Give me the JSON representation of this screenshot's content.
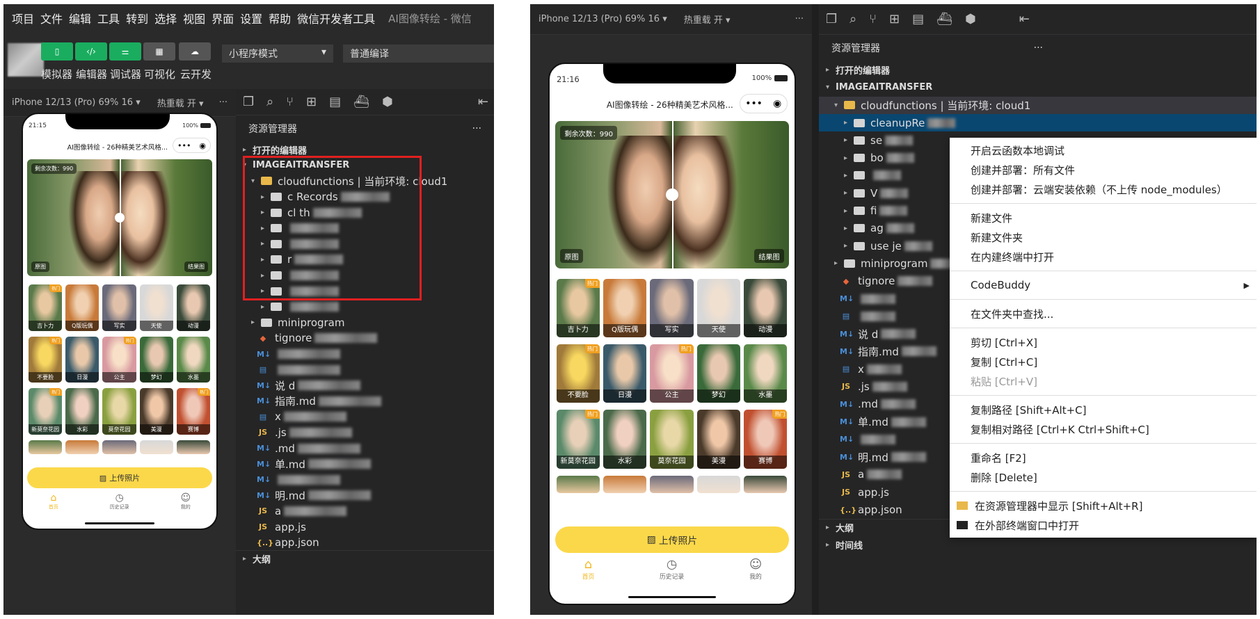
{
  "menu": [
    "项目",
    "文件",
    "编辑",
    "工具",
    "转到",
    "选择",
    "视图",
    "界面",
    "设置",
    "帮助",
    "微信开发者工具"
  ],
  "window_title": "AI图像转绘 - 微信",
  "toolbar": {
    "buttons": [
      "模拟器",
      "编辑器",
      "调试器",
      "可视化",
      "云开发"
    ],
    "mode_select": "小程序模式",
    "compile_select": "普通编译"
  },
  "device_bar": {
    "device": "iPhone 12/13 (Pro) 69% 16 ▾",
    "hot_reload": "热重载 开 ▾",
    "more": "···"
  },
  "phone": {
    "left_time": "21:15",
    "right_time": "21:16",
    "battery": "100%",
    "page_title": "AI图像转绘 - 26种精美艺术风格...",
    "remaining": "剩余次数：990",
    "original_label": "原图",
    "result_label": "结果图",
    "hot_tag": "热门",
    "styles": [
      "吉卜力",
      "Q版玩偶",
      "写实",
      "天使",
      "动漫",
      "不要脸",
      "日漫",
      "公主",
      "梦幻",
      "水墨",
      "新莫奈花园",
      "水彩",
      "莫奈花园",
      "美漫",
      "赛博"
    ],
    "hot_flags": [
      true,
      false,
      false,
      false,
      false,
      true,
      false,
      true,
      false,
      false,
      true,
      false,
      false,
      false,
      true
    ],
    "upload_button": "上传照片",
    "tabs": [
      "首页",
      "历史记录",
      "我的"
    ]
  },
  "explorer": {
    "title": "资源管理器",
    "more": "···",
    "open_editors": "打开的编辑器",
    "project": "IMAGEAITRANSFER",
    "cloudfunctions": "cloudfunctions | 当前环境: cloud1",
    "left_subfolders": [
      "c  Records",
      "cl  th",
      "",
      "",
      "r",
      "",
      "",
      ""
    ],
    "right_subfolders": [
      "cleanupRe",
      "se",
      "bo",
      "",
      "V",
      "fi",
      "ag",
      "use je"
    ],
    "miniprogram": "miniprogram",
    "left_files": [
      {
        "icon": "git",
        "name": "  tignore",
        "color": "#e8663a"
      },
      {
        "icon": "md",
        "name": "",
        "color": "#4a8fd8"
      },
      {
        "icon": "doc",
        "name": "",
        "color": "#4a8fd8"
      },
      {
        "icon": "md",
        "name": "  说  d",
        "color": "#4a8fd8"
      },
      {
        "icon": "md",
        "name": "  指南.md",
        "color": "#4a8fd8"
      },
      {
        "icon": "doc",
        "name": "  x",
        "color": "#4a8fd8"
      },
      {
        "icon": "js",
        "name": "  .js",
        "color": "#e8b84a"
      },
      {
        "icon": "md",
        "name": "  .md",
        "color": "#4a8fd8"
      },
      {
        "icon": "md",
        "name": "  单.md",
        "color": "#4a8fd8"
      },
      {
        "icon": "md",
        "name": "",
        "color": "#4a8fd8"
      },
      {
        "icon": "md",
        "name": "  明.md",
        "color": "#4a8fd8"
      },
      {
        "icon": "js",
        "name": "a",
        "color": "#e8b84a"
      }
    ],
    "app_js": "app.js",
    "app_json": "app.json",
    "outline": "大纲",
    "timeline": "时间线"
  },
  "context_menu": [
    {
      "label": "开启云函数本地调试"
    },
    {
      "label": "创建并部署：所有文件"
    },
    {
      "label": "创建并部署：云端安装依赖（不上传 node_modules）"
    },
    {
      "sep": true
    },
    {
      "label": "新建文件"
    },
    {
      "label": "新建文件夹"
    },
    {
      "label": "在内建终端中打开"
    },
    {
      "sep": true
    },
    {
      "label": "CodeBuddy",
      "submenu": true
    },
    {
      "sep": true
    },
    {
      "label": "在文件夹中查找..."
    },
    {
      "sep": true
    },
    {
      "label": "剪切  [Ctrl+X]"
    },
    {
      "label": "复制  [Ctrl+C]"
    },
    {
      "label": "粘贴  [Ctrl+V]",
      "disabled": true
    },
    {
      "sep": true
    },
    {
      "label": "复制路径  [Shift+Alt+C]"
    },
    {
      "label": "复制相对路径  [Ctrl+K Ctrl+Shift+C]"
    },
    {
      "sep": true
    },
    {
      "label": "重命名  [F2]"
    },
    {
      "label": "删除  [Delete]"
    },
    {
      "sep": true
    },
    {
      "label": "在资源管理器中显示  [Shift+Alt+R]",
      "icon": "folder"
    },
    {
      "label": "在外部终端窗口中打开",
      "icon": "terminal"
    }
  ],
  "highlight_color": "#e02020",
  "accent_green": "#1aad5f",
  "upload_yellow": "#fbd84a"
}
